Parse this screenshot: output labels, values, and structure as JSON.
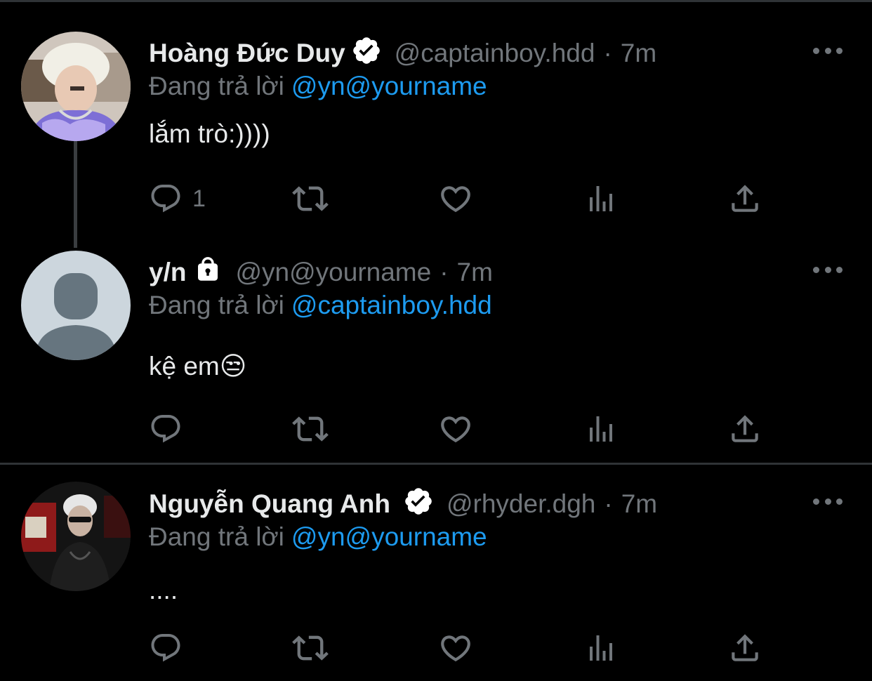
{
  "tweets": [
    {
      "display_name": "Hoàng Đức Duy",
      "handle": "@captainboy.hdd",
      "time": "7m",
      "reply_prefix": "Đang trả lời",
      "reply_to": "@yn@yourname",
      "text": "lắm trò:))))",
      "badge": "verified-icon",
      "reply_count": "1"
    },
    {
      "display_name": "y/n",
      "handle": "@yn@yourname",
      "time": "7m",
      "reply_prefix": "Đang trả lời",
      "reply_to": "@captainboy.hdd",
      "text": "kệ em😒",
      "badge": "lock-icon",
      "reply_count": ""
    },
    {
      "display_name": "Nguyễn Quang Anh",
      "handle": "@rhyder.dgh",
      "time": "7m",
      "reply_prefix": "Đang trả lời",
      "reply_to": "@yn@yourname",
      "text": "....",
      "badge": "verified-icon",
      "reply_count": ""
    }
  ],
  "separator": "·",
  "colors": {
    "background": "#000000",
    "text": "#e7e9ea",
    "muted": "#71767b",
    "link": "#1d9bf0",
    "divider": "#2f3336"
  },
  "icons": [
    "reply-icon",
    "retweet-icon",
    "like-icon",
    "analytics-icon",
    "share-icon",
    "more-options-icon"
  ]
}
